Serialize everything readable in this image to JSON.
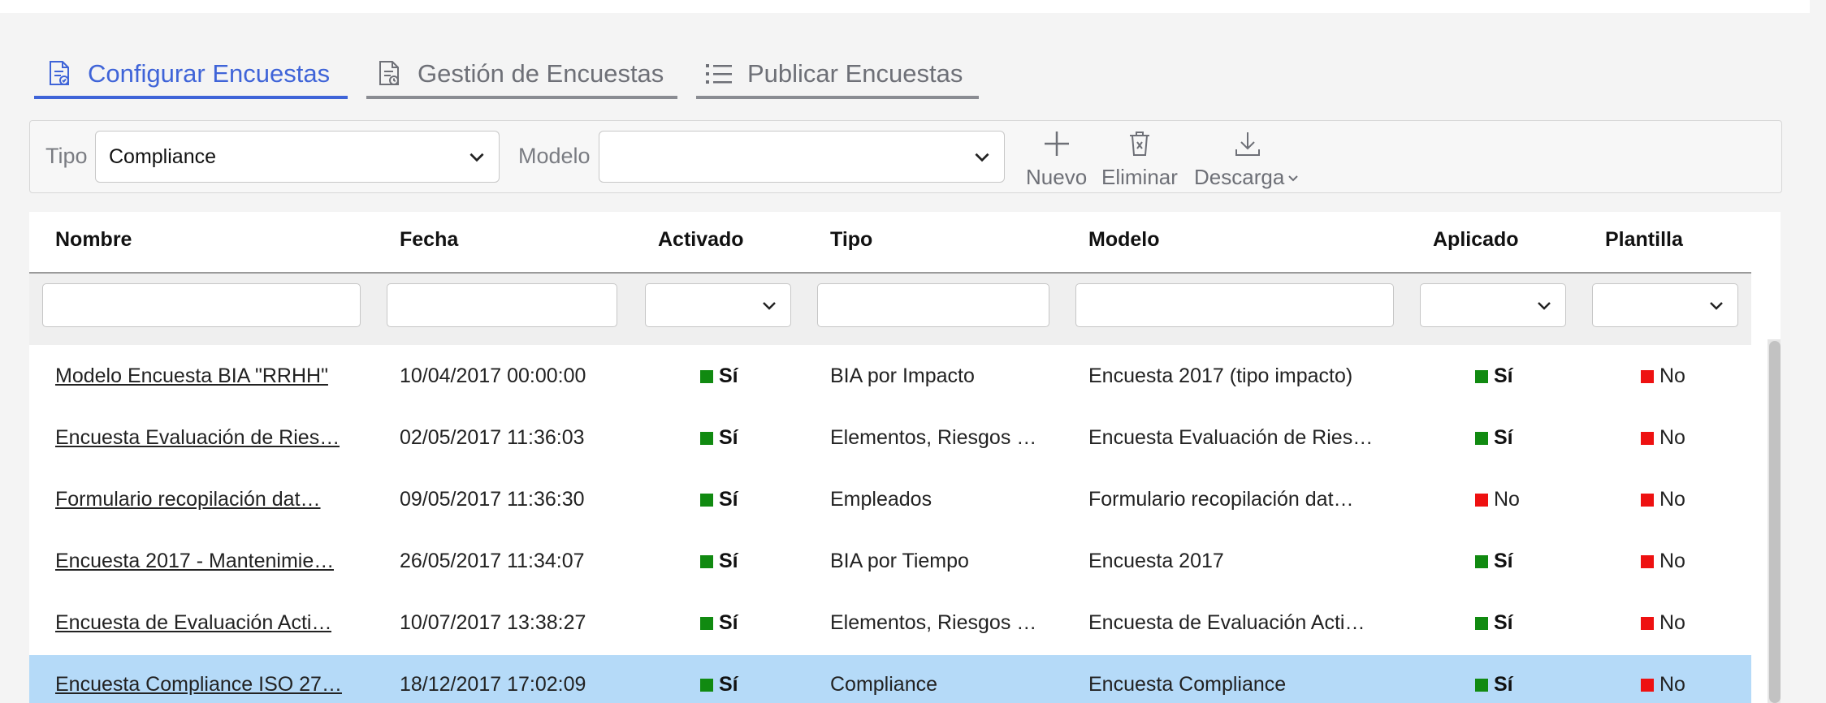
{
  "tabs": [
    {
      "label": "Configurar Encuestas",
      "icon": "survey-config-icon",
      "active": true
    },
    {
      "label": "Gestión de Encuestas",
      "icon": "survey-manage-icon",
      "active": false
    },
    {
      "label": "Publicar Encuestas",
      "icon": "list-icon",
      "active": false
    }
  ],
  "toolbar": {
    "tipo_label": "Tipo",
    "tipo_value": "Compliance",
    "modelo_label": "Modelo",
    "modelo_value": "",
    "nuevo_label": "Nuevo",
    "eliminar_label": "Eliminar",
    "descarga_label": "Descarga"
  },
  "table": {
    "columns": [
      "Nombre",
      "Fecha",
      "Activado",
      "Tipo",
      "Modelo",
      "Aplicado",
      "Plantilla"
    ],
    "rows": [
      {
        "nombre": "Modelo Encuesta BIA \"RRHH\"",
        "fecha": "10/04/2017 00:00:00",
        "activado": "Sí",
        "tipo": "BIA por Impacto",
        "modelo": "Encuesta 2017 (tipo impacto)",
        "aplicado": "Sí",
        "plantilla": "No"
      },
      {
        "nombre": "Encuesta Evaluación de Ries…",
        "fecha": "02/05/2017 11:36:03",
        "activado": "Sí",
        "tipo": "Elementos, Riesgos …",
        "modelo": "Encuesta Evaluación de Ries…",
        "aplicado": "Sí",
        "plantilla": "No"
      },
      {
        "nombre": "Formulario recopilación dat…",
        "fecha": "09/05/2017 11:36:30",
        "activado": "Sí",
        "tipo": "Empleados",
        "modelo": "Formulario recopilación dat…",
        "aplicado": "No",
        "plantilla": "No"
      },
      {
        "nombre": "Encuesta 2017 - Mantenimie…",
        "fecha": "26/05/2017 11:34:07",
        "activado": "Sí",
        "tipo": "BIA por Tiempo",
        "modelo": "Encuesta 2017",
        "aplicado": "Sí",
        "plantilla": "No"
      },
      {
        "nombre": "Encuesta de Evaluación Acti…",
        "fecha": "10/07/2017 13:38:27",
        "activado": "Sí",
        "tipo": "Elementos, Riesgos …",
        "modelo": "Encuesta de Evaluación Acti…",
        "aplicado": "Sí",
        "plantilla": "No"
      },
      {
        "nombre": "Encuesta Compliance ISO 27…",
        "fecha": "18/12/2017 17:02:09",
        "activado": "Sí",
        "tipo": "Compliance",
        "modelo": "Encuesta Compliance",
        "aplicado": "Sí",
        "plantilla": "No",
        "selected": true
      }
    ]
  },
  "colors": {
    "accent": "#3f64d8",
    "yes": "#118a11",
    "no": "#ee1111",
    "selected_row": "#b5daf8"
  }
}
